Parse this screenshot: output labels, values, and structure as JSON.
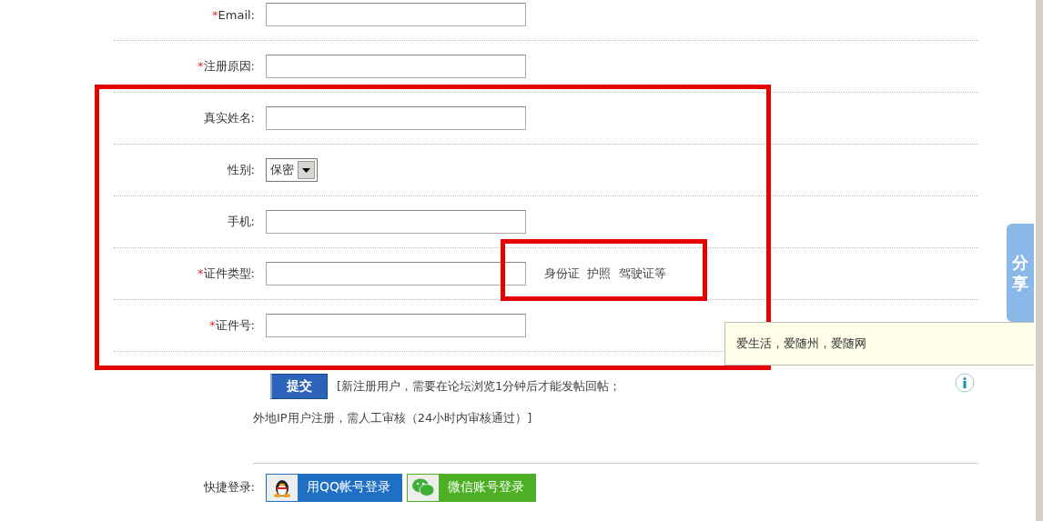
{
  "form": {
    "fields": [
      {
        "label": "Email:",
        "required": true,
        "kind": "text"
      },
      {
        "label": "注册原因:",
        "required": true,
        "kind": "text"
      },
      {
        "label": "真实姓名:",
        "required": false,
        "kind": "text"
      },
      {
        "label": "性别:",
        "required": false,
        "kind": "select",
        "value": "保密"
      },
      {
        "label": "手机:",
        "required": false,
        "kind": "text"
      },
      {
        "label": "证件类型:",
        "required": true,
        "kind": "text",
        "hint": "身份证  护照  驾驶证等"
      },
      {
        "label": "证件号:",
        "required": true,
        "kind": "text"
      }
    ],
    "required_mark": "*",
    "submit": {
      "label": "提交",
      "note_line_1": "[新注册用户，需要在论坛浏览1分钟后才能发帖回帖；",
      "note_line_2": "外地IP用户注册，需人工审核（24小时内审核通过）]"
    },
    "quick_login": {
      "label": "快捷登录:",
      "buttons": [
        {
          "kind": "qq",
          "label": "用QQ帐号登录"
        },
        {
          "kind": "wechat",
          "label": "微信账号登录"
        }
      ]
    }
  },
  "share_tab": {
    "label": "分享"
  },
  "tooltip": {
    "text": "爱生活，爱随州，爱随网"
  }
}
